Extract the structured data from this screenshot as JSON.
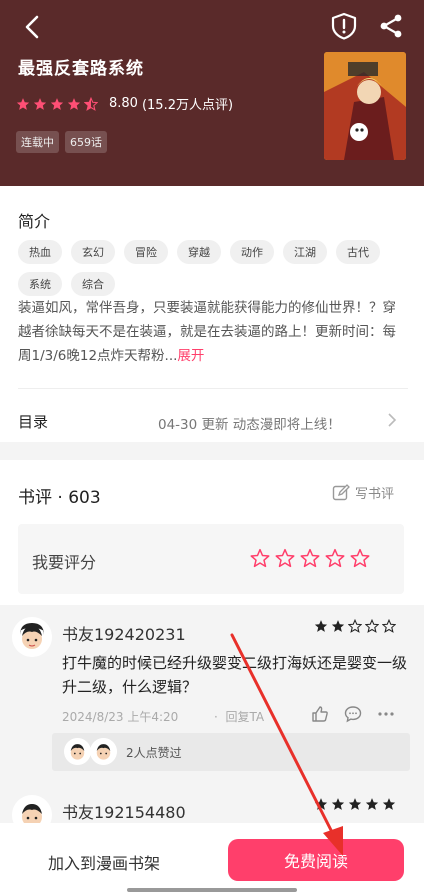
{
  "header": {
    "title": "最强反套路系统",
    "rating_value": "8.80",
    "rating_count": "(15.2万人点评)",
    "rating_stars": 4.5,
    "status_tags": [
      "连载中",
      "659话"
    ]
  },
  "intro": {
    "title": "简介",
    "genres": [
      "热血",
      "玄幻",
      "冒险",
      "穿越",
      "动作",
      "江湖",
      "古代",
      "系统",
      "综合"
    ],
    "summary": "装逼如风，常伴吾身，只要装逼就能获得能力的修仙世界！？穿越者徐缺每天不是在装逼，就是在去装逼的路上！更新时间：每周1/3/6晚12点炸天帮粉...",
    "expand": "展开"
  },
  "toc": {
    "label": "目录",
    "info": "04-30 更新  动态漫即将上线！"
  },
  "reviews": {
    "title": "书评 · 603",
    "write_label": "写书评",
    "rate_label": "我要评分",
    "items": [
      {
        "user": "书友192420231",
        "stars": 2,
        "text": "打牛魔的时候已经升级婴变二级打海妖还是婴变一级升二级，什么逻辑？",
        "date": "2024/8/23 上午4:20",
        "reply": "回复TA",
        "likes_text": "2人点赞过"
      },
      {
        "user": "书友192154480",
        "stars": 5
      }
    ]
  },
  "bottom": {
    "add_shelf": "加入到漫画书架",
    "read_free": "免费阅读"
  },
  "colors": {
    "accent": "#ff3f6b",
    "header_bg": "#5a2a2a",
    "annotation": "#e8302a"
  }
}
